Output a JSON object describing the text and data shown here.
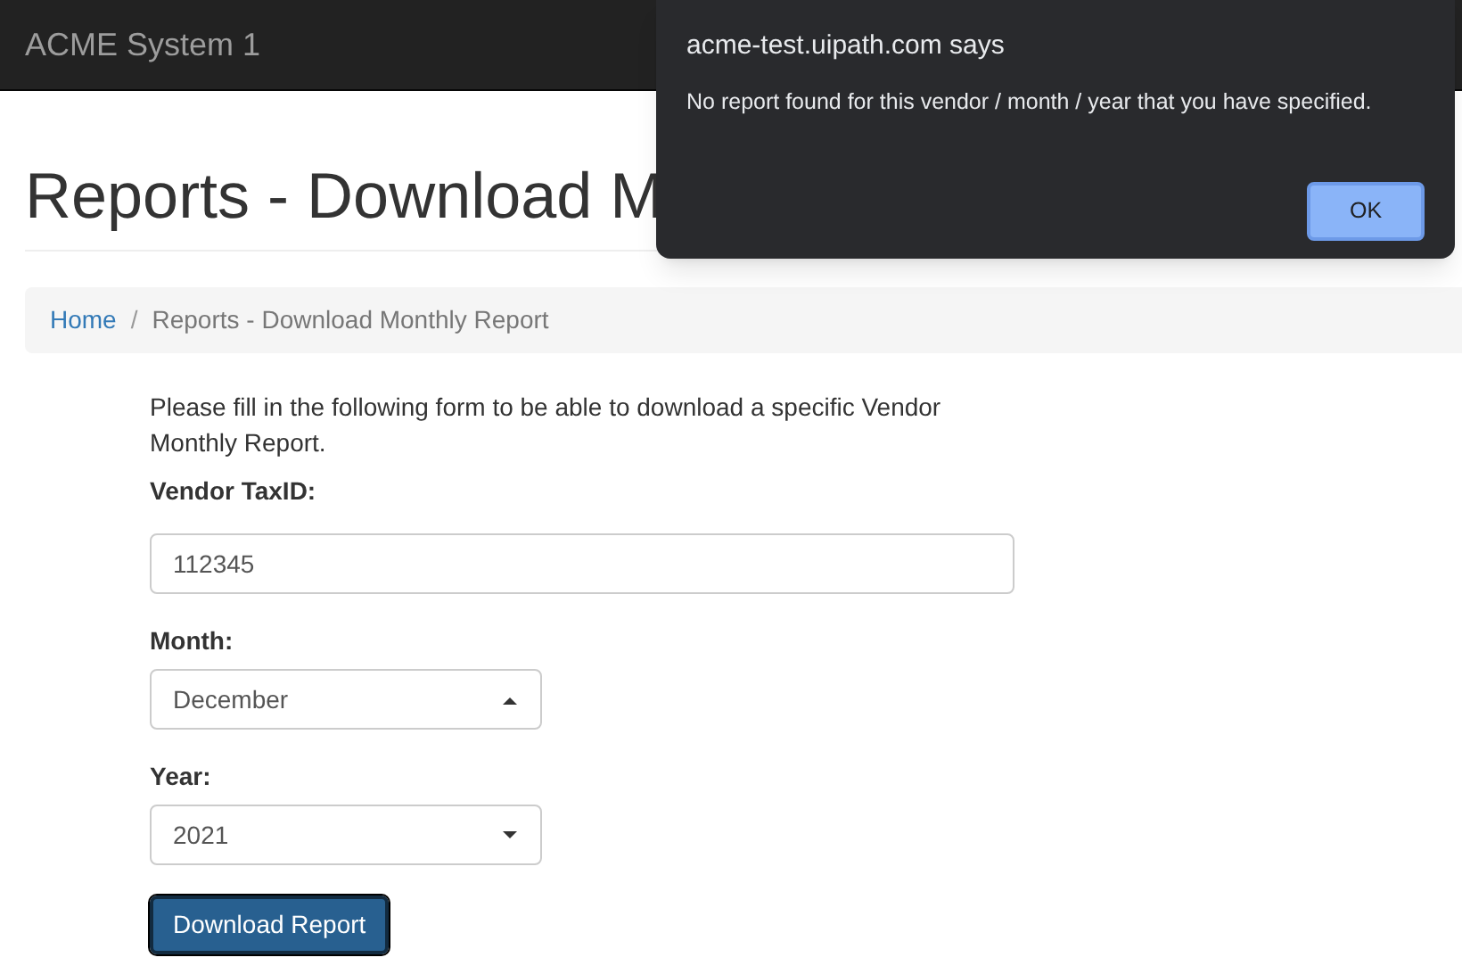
{
  "navbar": {
    "brand": "ACME System 1"
  },
  "page_title": "Reports - Download M",
  "breadcrumb_separator": "/",
  "breadcrumb": [
    {
      "label": "Home",
      "kind": "link"
    },
    {
      "label": "Reports - Download Monthly Report",
      "kind": "current"
    }
  ],
  "form": {
    "intro": "Please fill in the following form to be able to download a specific Vendor Monthly Report.",
    "fields": [
      {
        "label": "Vendor TaxID:",
        "kind": "text",
        "value": "112345"
      },
      {
        "label": "Month:",
        "kind": "select",
        "value": "December",
        "expanded": true
      },
      {
        "label": "Year:",
        "kind": "select",
        "value": "2021",
        "expanded": false
      }
    ],
    "submit": "Download Report"
  },
  "dialog": {
    "title": "acme-test.uipath.com says",
    "message": "No report found for this vendor / month / year that you have specified.",
    "button": "OK"
  }
}
